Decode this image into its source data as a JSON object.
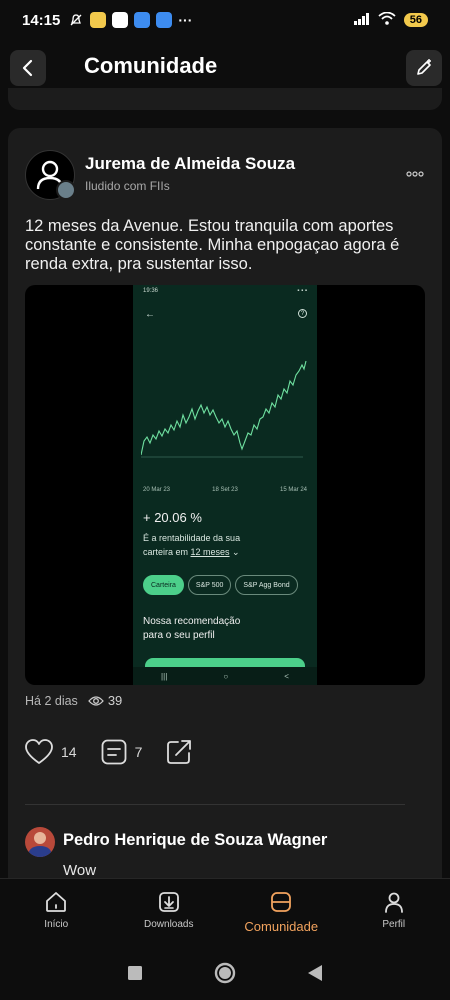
{
  "status_bar": {
    "time": "14:15",
    "battery": "56"
  },
  "header": {
    "title": "Comunidade"
  },
  "post": {
    "author": "Jurema de Almeida Souza",
    "subtitle": "Iludido com FIIs",
    "text": "12 meses da Avenue. Estou tranquila com aportes constante e consistente. Minha enpogaçao agora é renda extra, pra sustentar isso.",
    "time_ago": "Há 2 dias",
    "views": "39",
    "likes": "14",
    "comments": "7",
    "screenshot": {
      "status_time": "19:36",
      "back": "←",
      "help": "?",
      "dates": [
        "20 Mar 23",
        "18 Set 23",
        "15 Mar 24"
      ],
      "percentage": "+ 20.06 %",
      "desc_line1": "É a rentabilidade da sua",
      "desc_prefix": "carteira em ",
      "desc_link": "12 meses",
      "desc_suffix": " ⌄",
      "chips": [
        "Carteira",
        "S&P 500",
        "S&P Agg Bond"
      ],
      "reco_line1": "Nossa recomendação",
      "reco_line2": "para o seu perfil",
      "nav": [
        "|||",
        "○",
        "<"
      ]
    }
  },
  "comment": {
    "author": "Pedro Henrique de Souza Wagner",
    "text": "Wow"
  },
  "bottom_nav": {
    "items": [
      {
        "label": "Início",
        "icon": "home-icon"
      },
      {
        "label": "Downloads",
        "icon": "download-icon"
      },
      {
        "label": "Comunidade",
        "icon": "community-icon"
      },
      {
        "label": "Perfil",
        "icon": "profile-icon"
      }
    ],
    "active": "Comunidade",
    "active_color": "#f2a35e"
  }
}
